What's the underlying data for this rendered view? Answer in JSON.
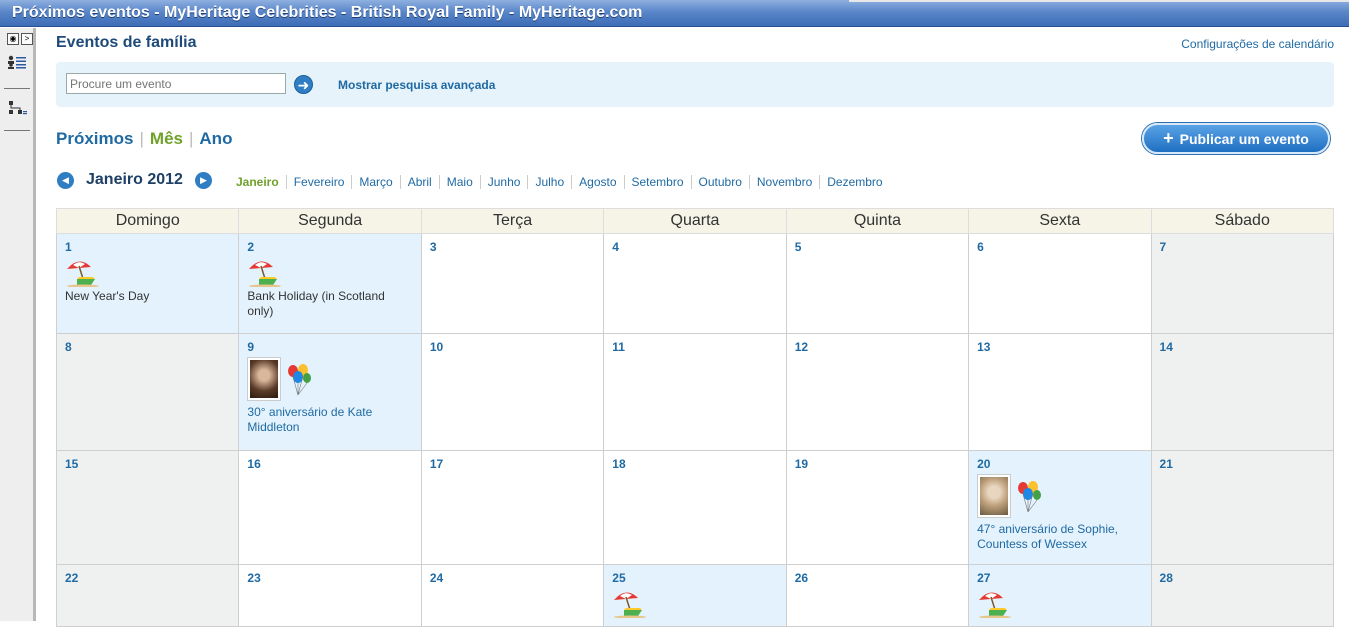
{
  "window": {
    "title": "Próximos eventos - MyHeritage Celebrities - British Royal Family - MyHeritage.com"
  },
  "header": {
    "title": "Eventos de família",
    "settings_link": "Configurações de calendário"
  },
  "search": {
    "placeholder": "Procure um evento",
    "advanced_link": "Mostrar pesquisa avançada"
  },
  "view_tabs": {
    "upcoming": "Próximos",
    "month": "Mês",
    "year": "Ano",
    "separator": "|"
  },
  "publish_button": {
    "label": "Publicar um evento"
  },
  "month_nav": {
    "current": "Janeiro 2012",
    "months": [
      "Janeiro",
      "Fevereiro",
      "Março",
      "Abril",
      "Maio",
      "Junho",
      "Julho",
      "Agosto",
      "Setembro",
      "Outubro",
      "Novembro",
      "Dezembro"
    ]
  },
  "calendar": {
    "weekdays": [
      "Domingo",
      "Segunda",
      "Terça",
      "Quarta",
      "Quinta",
      "Sexta",
      "Sábado"
    ],
    "weeks": [
      [
        {
          "day": "1",
          "type": "event",
          "icon": "beach-umbrella-icon",
          "text": "New Year's Day"
        },
        {
          "day": "2",
          "type": "event",
          "icon": "beach-umbrella-icon",
          "text": "Bank Holiday (in Scotland only)"
        },
        {
          "day": "3"
        },
        {
          "day": "4"
        },
        {
          "day": "5"
        },
        {
          "day": "6"
        },
        {
          "day": "7",
          "type": "weekend"
        }
      ],
      [
        {
          "day": "8",
          "type": "weekend"
        },
        {
          "day": "9",
          "type": "event",
          "icon": "birthday-balloons-icon",
          "photo": "dark",
          "text": "30° aniversário de Kate Middleton",
          "link": true
        },
        {
          "day": "10"
        },
        {
          "day": "11"
        },
        {
          "day": "12"
        },
        {
          "day": "13"
        },
        {
          "day": "14",
          "type": "weekend"
        }
      ],
      [
        {
          "day": "15",
          "type": "weekend"
        },
        {
          "day": "16"
        },
        {
          "day": "17"
        },
        {
          "day": "18"
        },
        {
          "day": "19"
        },
        {
          "day": "20",
          "type": "event",
          "icon": "birthday-balloons-icon",
          "photo": "light",
          "text": "47° aniversário de Sophie, Countess of Wessex",
          "link": true
        },
        {
          "day": "21",
          "type": "weekend"
        }
      ],
      [
        {
          "day": "22",
          "type": "weekend"
        },
        {
          "day": "23"
        },
        {
          "day": "24"
        },
        {
          "day": "25",
          "type": "event",
          "icon": "beach-umbrella-icon"
        },
        {
          "day": "26"
        },
        {
          "day": "27",
          "type": "event",
          "icon": "beach-umbrella-icon"
        },
        {
          "day": "28",
          "type": "weekend"
        }
      ]
    ]
  },
  "colors": {
    "link": "#1f6aa3",
    "active": "#6fa22a",
    "event_bg": "#e3f2fc",
    "weekend_bg": "#eff1f0",
    "header_bg": "#f5f4e6"
  }
}
